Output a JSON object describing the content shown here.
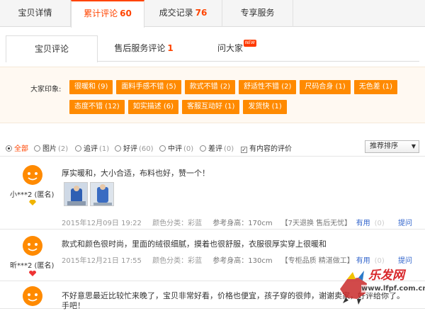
{
  "top_tabs": [
    {
      "label": "宝贝详情",
      "count": ""
    },
    {
      "label": "累计评论",
      "count": "60"
    },
    {
      "label": "成交记录",
      "count": "76"
    },
    {
      "label": "专享服务",
      "count": ""
    }
  ],
  "sub_tabs": [
    {
      "label": "宝贝评论",
      "count": ""
    },
    {
      "label": "售后服务评论",
      "count": "1"
    },
    {
      "label": "问大家",
      "badge": "NEW"
    }
  ],
  "impression": {
    "label": "大家印象:",
    "tags": [
      "很暖和 (9)",
      "面料手感不错 (5)",
      "款式不错 (2)",
      "舒适性不错 (2)",
      "尺码合身 (1)",
      "无色差 (1)",
      "态度不错 (12)",
      "如实描述 (6)",
      "客服互动好 (1)",
      "发货快 (1)"
    ]
  },
  "filters": {
    "items": [
      {
        "label": "全部",
        "count": ""
      },
      {
        "label": "图片",
        "count": "(2)"
      },
      {
        "label": "追评",
        "count": "(1)"
      },
      {
        "label": "好评",
        "count": "(60)"
      },
      {
        "label": "中评",
        "count": "(0)"
      },
      {
        "label": "差评",
        "count": "(0)"
      }
    ],
    "content_only": "有内容的评价",
    "sort_label": "推荐排序"
  },
  "reviews": [
    {
      "user": "小***2 (匿名)",
      "text": "厚实暖和，大小合适，布料也好，赞一个！",
      "date": "2015年12月09日 19:22",
      "color": "颜色分类：彩蓝",
      "height": "参考身高：170cm",
      "extra": "【7天退换 售后无忧】",
      "useful": "有用",
      "count": "(0)",
      "reply": "提问"
    },
    {
      "user": "昕***2 (匿名)",
      "text": "款式和颜色很时尚，里面的绒很细腻，摸着也很舒服，衣服很厚实穿上很暖和",
      "date": "2015年12月21日 17:55",
      "color": "颜色分类：彩蓝",
      "height": "参考身高：130cm",
      "extra": "【专柜品质 精湛做工】",
      "useful": "有用",
      "count": "(0)",
      "reply": "提问"
    },
    {
      "user": "",
      "text": "不好意思最近比较忙来晚了，宝贝非常好看，价格也便宜，孩子穿的很帅，谢谢卖家，好评给你了。",
      "text2": "手吧！"
    }
  ],
  "watermark": {
    "title": "乐发网",
    "url": "www.lfpf.com.cn"
  }
}
